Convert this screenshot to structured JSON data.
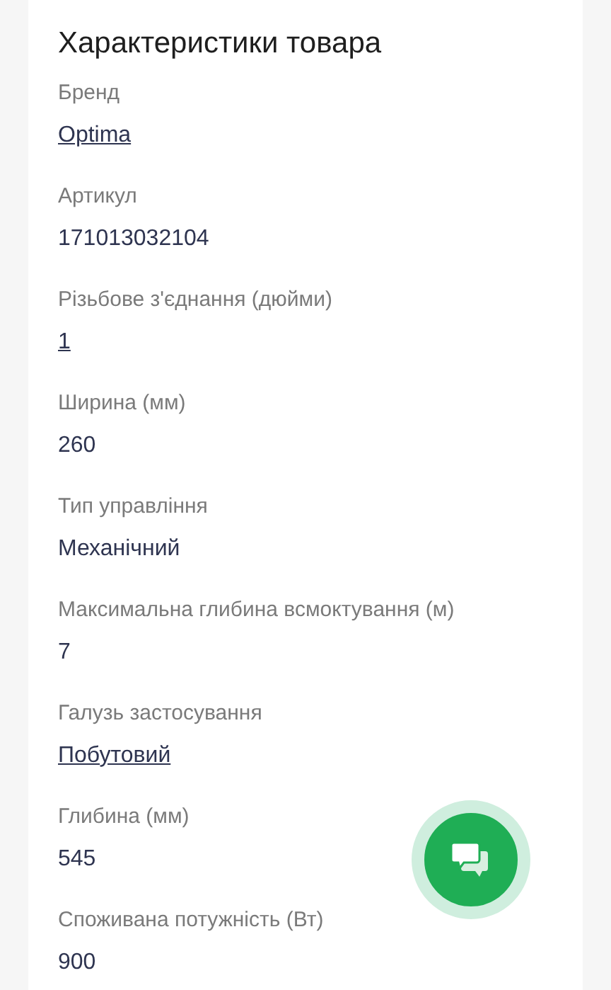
{
  "title": "Характеристики товара",
  "specs": [
    {
      "label": "Бренд",
      "value": "Optima",
      "kind": "link"
    },
    {
      "label": "Артикул",
      "value": "171013032104",
      "kind": "text"
    },
    {
      "label": "Різьбове з'єднання (дюйми)",
      "value": "1",
      "kind": "link"
    },
    {
      "label": "Ширина (мм)",
      "value": "260",
      "kind": "text"
    },
    {
      "label": "Тип управління",
      "value": "Механічний",
      "kind": "text"
    },
    {
      "label": "Максимальна глибина всмоктування (м)",
      "value": "7",
      "kind": "text"
    },
    {
      "label": "Галузь застосування",
      "value": "Побутовий",
      "kind": "link"
    },
    {
      "label": "Глибина (мм)",
      "value": "545",
      "kind": "text"
    },
    {
      "label": "Споживана потужність (Вт)",
      "value": "900",
      "kind": "text"
    }
  ]
}
